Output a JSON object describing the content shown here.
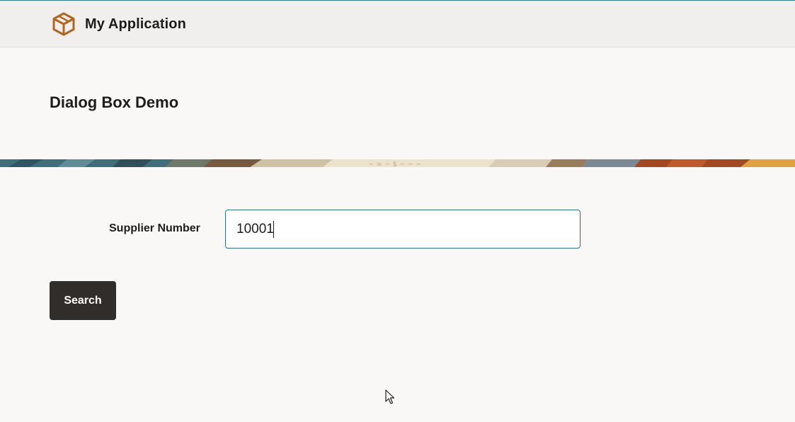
{
  "header": {
    "logo_icon": "cube-icon",
    "app_title": "My Application",
    "accent_color": "#2e7d8c"
  },
  "page": {
    "title": "Dialog Box Demo"
  },
  "form": {
    "supplier_label": "Supplier Number",
    "supplier_value": "10001",
    "search_label": "Search"
  },
  "colors": {
    "logo": "#b2661f",
    "button_bg": "#312d2a",
    "input_border": "#2b6f82",
    "background": "#f9f8f6"
  }
}
